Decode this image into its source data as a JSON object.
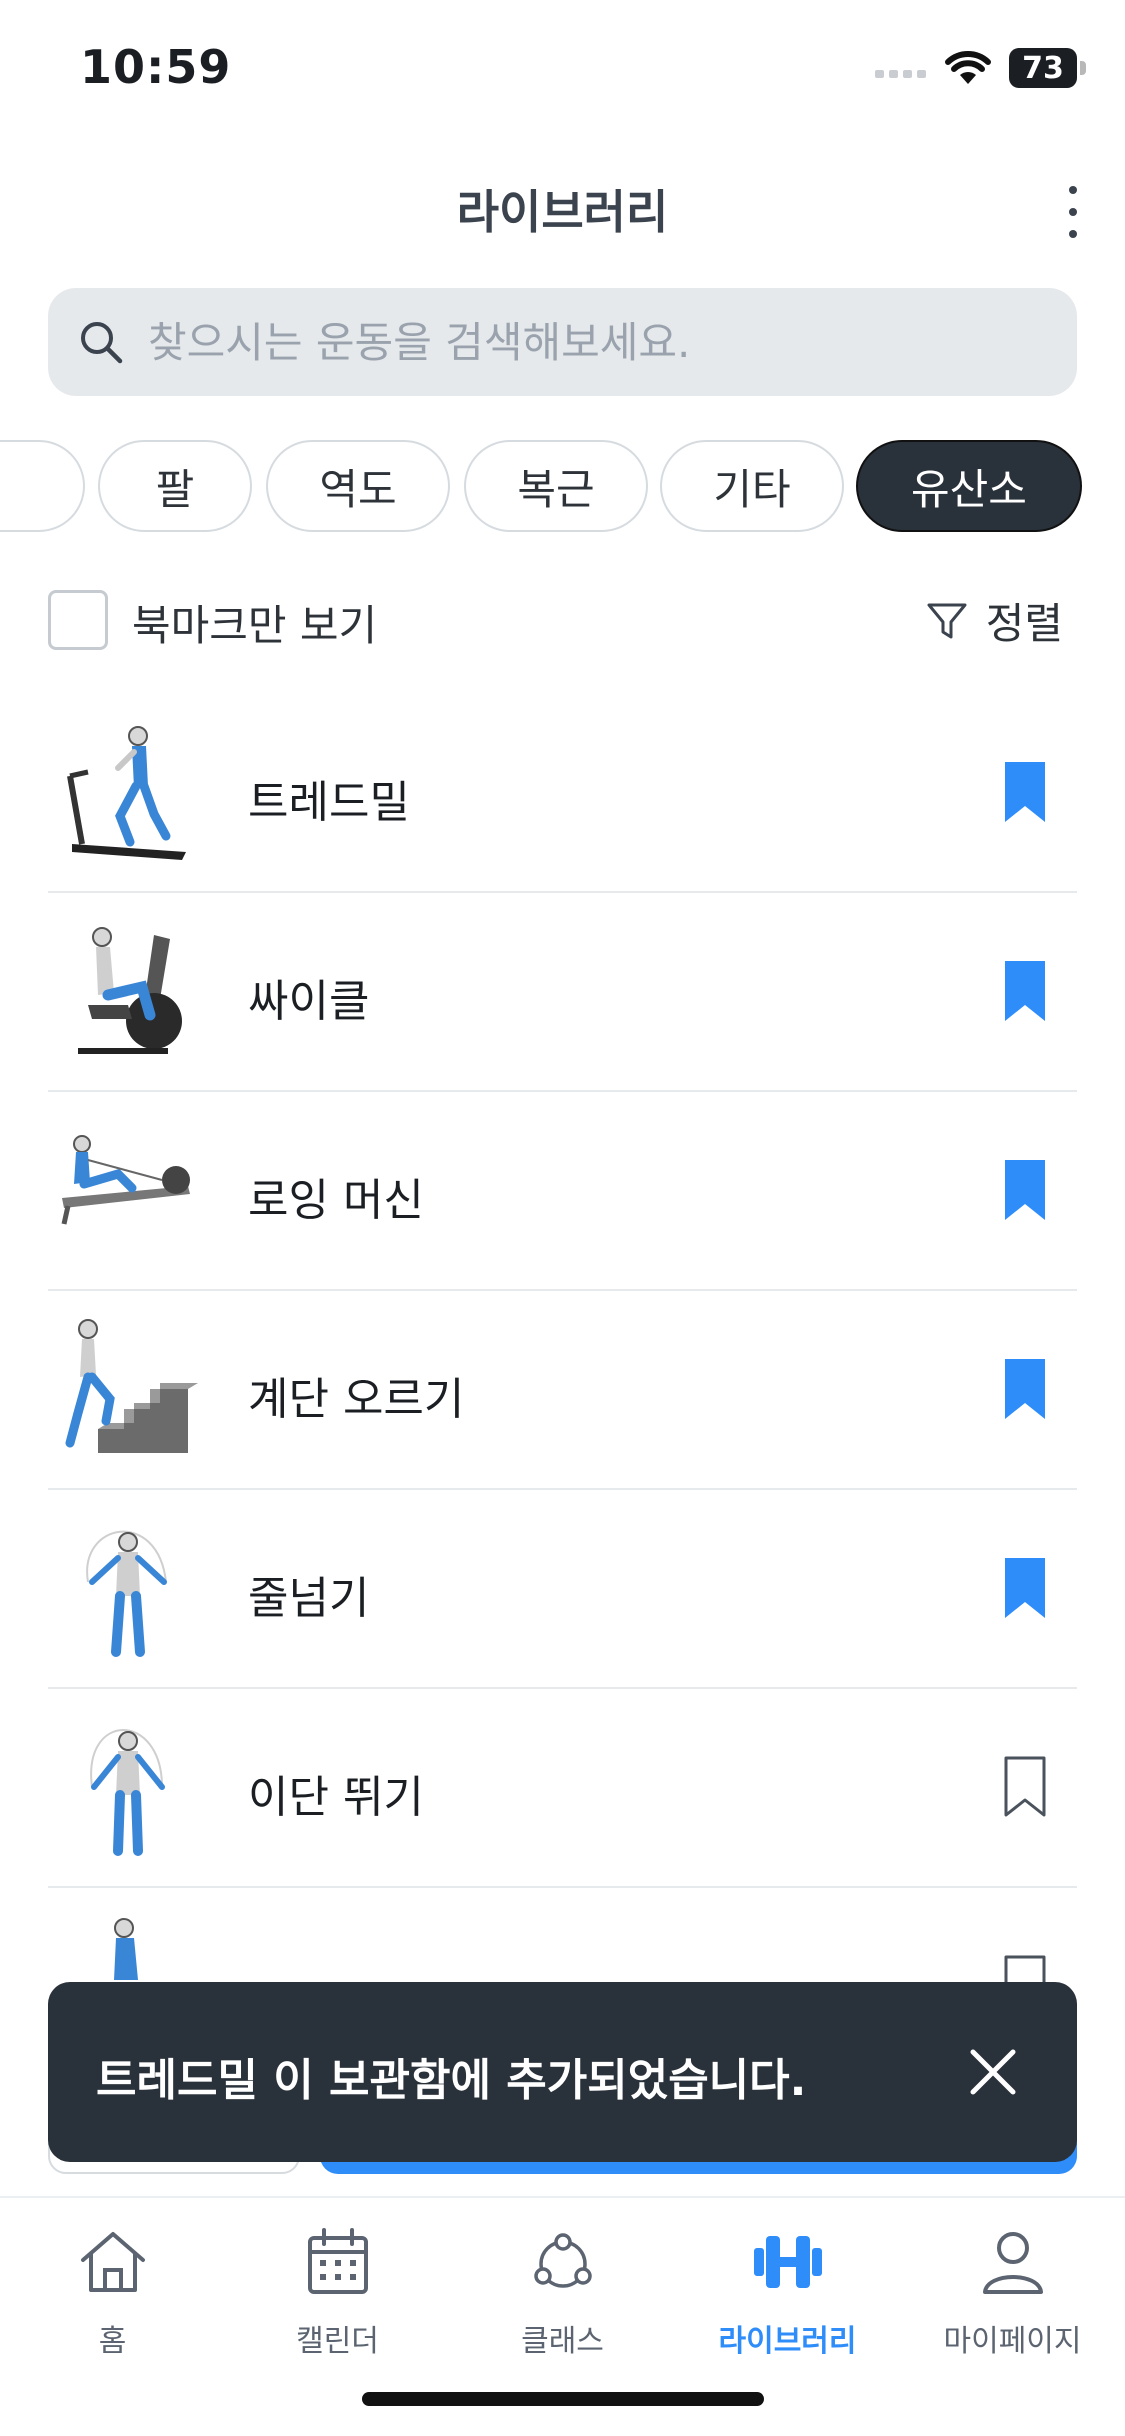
{
  "status_bar": {
    "time": "10:59",
    "battery": "73",
    "icons": [
      "cellular-signal-icon",
      "wifi-icon",
      "battery-icon"
    ]
  },
  "header": {
    "title": "라이브러리",
    "more_icon": "more-vertical-icon"
  },
  "search": {
    "placeholder": "찾으시는 운동을 검색해보세요.",
    "value": "",
    "icon": "search-icon"
  },
  "categories": {
    "items": [
      "팔",
      "역도",
      "복근",
      "기타",
      "유산소"
    ],
    "selected": "유산소"
  },
  "filter": {
    "bookmark_only_label": "북마크만 보기",
    "bookmark_only_checked": false,
    "sort_label": "정렬"
  },
  "exercises": [
    {
      "name": "트레드밀",
      "bookmarked": true
    },
    {
      "name": "싸이클",
      "bookmarked": true
    },
    {
      "name": "로잉 머신",
      "bookmarked": true
    },
    {
      "name": "계단 오르기",
      "bookmarked": true
    },
    {
      "name": "줄넘기",
      "bookmarked": true
    },
    {
      "name": "이단 뛰기",
      "bookmarked": false
    }
  ],
  "toast": {
    "message": "트레드밀 이 보관함에 추가되었습니다."
  },
  "tab_bar": {
    "items": [
      {
        "label": "홈",
        "icon": "home-icon"
      },
      {
        "label": "캘린더",
        "icon": "calendar-icon"
      },
      {
        "label": "클래스",
        "icon": "class-network-icon"
      },
      {
        "label": "라이브러리",
        "icon": "dumbbell-icon"
      },
      {
        "label": "마이페이지",
        "icon": "user-icon"
      }
    ],
    "active": "라이브러리"
  },
  "colors": {
    "accent": "#2f8dfa",
    "dark": "#29313a",
    "search_bg": "#e6e9ec"
  }
}
